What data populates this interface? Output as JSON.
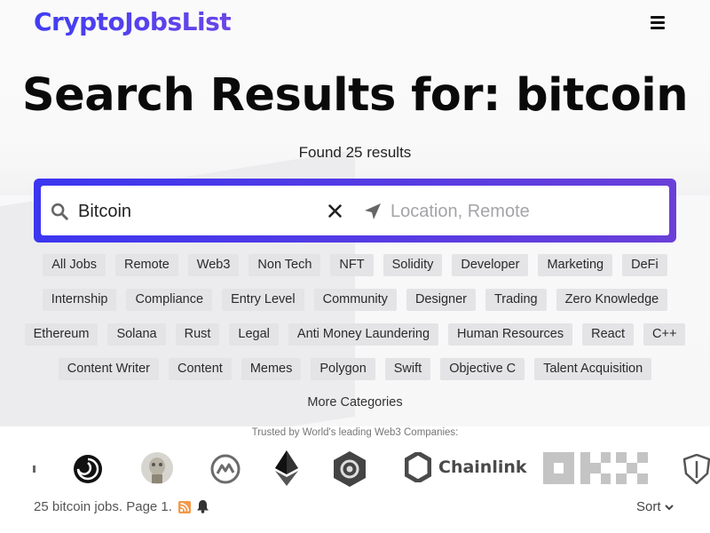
{
  "header": {
    "logo_text": "CryptoJobsList",
    "menu_icon": "hamburger-menu-icon"
  },
  "page": {
    "title": "Search Results for: bitcoin",
    "results_count": "Found 25 results"
  },
  "search": {
    "query_value": "Bitcoin",
    "location_placeholder": "Location, Remote",
    "search_icon": "search-icon",
    "clear_icon": "close-icon",
    "location_icon": "location-arrow-icon",
    "accent_start": "#3c36f0",
    "accent_end": "#6a3fd9"
  },
  "tags": {
    "rows": [
      [
        "All Jobs",
        "Remote",
        "Web3",
        "Non Tech",
        "NFT",
        "Solidity",
        "Developer",
        "Marketing",
        "DeFi"
      ],
      [
        "Internship",
        "Compliance",
        "Entry Level",
        "Community",
        "Designer",
        "Trading",
        "Zero Knowledge"
      ],
      [
        "Ethereum",
        "Solana",
        "Rust",
        "Legal",
        "Anti Money Laundering",
        "Human Resources",
        "React",
        "C++"
      ],
      [
        "Content Writer",
        "Content",
        "Memes",
        "Polygon",
        "Swift",
        "Objective C",
        "Talent Acquisition"
      ]
    ],
    "more_label": "More Categories"
  },
  "companies": {
    "trusted_text": "Trusted by World's leading Web3 Companies:",
    "logos": [
      "swirl-logo",
      "monkey-avatar-logo",
      "coinmarketcap-logo",
      "ethereum-logo",
      "signal-logo",
      "chainlink-logo",
      "okx-logo",
      "shield-logo"
    ],
    "chainlink_label": "Chainlink"
  },
  "footer": {
    "jobs_summary": "25 bitcoin jobs. Page 1.",
    "rss_icon": "rss-icon",
    "bell_icon": "bell-icon",
    "sort_label": "Sort",
    "rss_color": "#f2994a"
  }
}
